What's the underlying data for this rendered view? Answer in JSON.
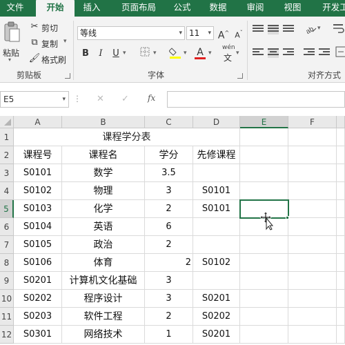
{
  "tabs": [
    "文件",
    "开始",
    "插入",
    "页面布局",
    "公式",
    "数据",
    "审阅",
    "视图",
    "开发工"
  ],
  "active_tab": "开始",
  "ribbon": {
    "clipboard": {
      "paste": "粘贴",
      "cut": "剪切",
      "copy": "复制",
      "format_painter": "格式刷",
      "group_label": "剪贴板"
    },
    "font": {
      "font_name": "等线",
      "font_size": "11",
      "grow": "A",
      "shrink": "A",
      "bold": "B",
      "italic": "I",
      "underline": "U",
      "font_color_glyph": "A",
      "phonetic": "wén",
      "phonetic_glyph": "文",
      "group_label": "字体"
    },
    "alignment": {
      "group_label": "对齐方式"
    }
  },
  "formula_bar": {
    "name_box": "E5",
    "formula": "",
    "cancel_glyph": "✕",
    "enter_glyph": "✓",
    "fx_glyph": "fx"
  },
  "sheet": {
    "columns": [
      "A",
      "B",
      "C",
      "D",
      "E",
      "F"
    ],
    "selected_column": "E",
    "rows": [
      "1",
      "2",
      "3",
      "4",
      "5",
      "6",
      "7",
      "8",
      "9",
      "10",
      "11",
      "12"
    ],
    "selected_row": "5",
    "title": "课程学分表",
    "headers": [
      "课程号",
      "课程名",
      "学分",
      "先修课程"
    ],
    "data": [
      [
        "S0101",
        "数学",
        "3.5",
        ""
      ],
      [
        "S0102",
        "物理",
        "3",
        "S0101"
      ],
      [
        "S0103",
        "化学",
        "2",
        "S0101"
      ],
      [
        "S0104",
        "英语",
        "6",
        ""
      ],
      [
        "S0105",
        "政治",
        "2",
        ""
      ],
      [
        "S0106",
        "体育",
        "2",
        "S0102"
      ],
      [
        "S0201",
        "计算机文化基础",
        "3",
        ""
      ],
      [
        "S0202",
        "程序设计",
        "3",
        "S0201"
      ],
      [
        "S0203",
        "软件工程",
        "2",
        "S0202"
      ],
      [
        "S0301",
        "网络技术",
        "1",
        "S0201"
      ]
    ],
    "active_cell": "E5"
  },
  "colors": {
    "accent": "#217346",
    "ribbon_bg": "#f3f3f3",
    "header_bg": "#e9e9e9",
    "font_color_bar": "#e02020"
  }
}
